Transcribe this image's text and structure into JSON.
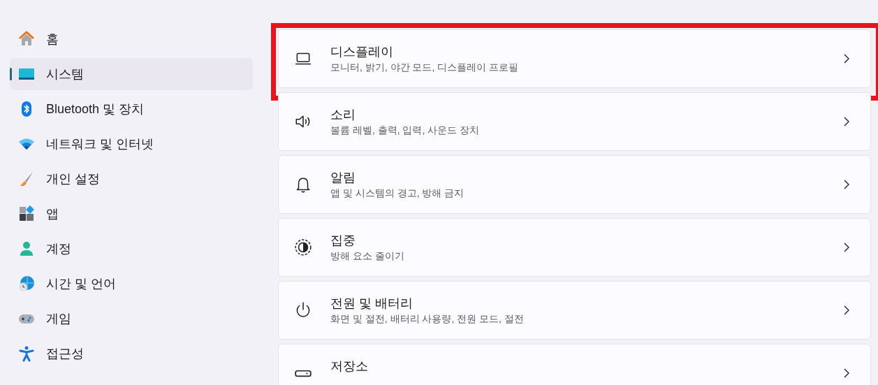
{
  "sidebar": {
    "items": [
      {
        "label": "홈",
        "selected": false
      },
      {
        "label": "시스템",
        "selected": true
      },
      {
        "label": "Bluetooth 및 장치",
        "selected": false
      },
      {
        "label": "네트워크 및 인터넷",
        "selected": false
      },
      {
        "label": "개인 설정",
        "selected": false
      },
      {
        "label": "앱",
        "selected": false
      },
      {
        "label": "계정",
        "selected": false
      },
      {
        "label": "시간 및 언어",
        "selected": false
      },
      {
        "label": "게임",
        "selected": false
      },
      {
        "label": "접근성",
        "selected": false
      }
    ]
  },
  "settings": [
    {
      "title": "디스플레이",
      "description": "모니터, 밝기, 야간 모드, 디스플레이 프로필",
      "highlighted": true
    },
    {
      "title": "소리",
      "description": "볼륨 레벨, 출력, 입력, 사운드 장치",
      "highlighted": false
    },
    {
      "title": "알림",
      "description": "앱 및 시스템의 경고, 방해 금지",
      "highlighted": false
    },
    {
      "title": "집중",
      "description": "방해 요소 줄이기",
      "highlighted": false
    },
    {
      "title": "전원 및 배터리",
      "description": "화면 및 절전, 배터리 사용량, 전원 모드, 절전",
      "highlighted": false
    },
    {
      "title": "저장소",
      "highlighted": false
    }
  ]
}
